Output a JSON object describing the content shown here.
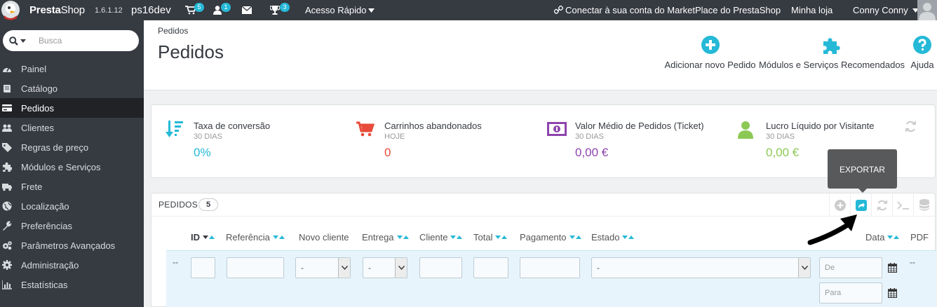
{
  "topbar": {
    "brand_presta": "Presta",
    "brand_shop": "Shop",
    "version": "1.6.1.12",
    "shop_name": "ps16dev",
    "badges": {
      "orders": "5",
      "customers": "1",
      "trophies": "3"
    },
    "quick_access": "Acesso Rápido",
    "marketplace": "Conectar à sua conta do MarketPlace do PrestaShop",
    "my_store": "Minha loja",
    "user": "Conny Conny"
  },
  "sidebar": {
    "search_placeholder": "Busca",
    "items": [
      {
        "label": "Painel",
        "icon": "dashboard-icon"
      },
      {
        "label": "Catálogo",
        "icon": "book-icon"
      },
      {
        "label": "Pedidos",
        "icon": "credit-card-icon",
        "active": true
      },
      {
        "label": "Clientes",
        "icon": "users-icon"
      },
      {
        "label": "Regras de preço",
        "icon": "tag-icon"
      },
      {
        "label": "Módulos e Serviços",
        "icon": "puzzle-icon"
      },
      {
        "label": "Frete",
        "icon": "truck-icon"
      },
      {
        "label": "Localização",
        "icon": "globe-icon"
      },
      {
        "label": "Preferências",
        "icon": "wrench-icon"
      },
      {
        "label": "Parâmetros Avançados",
        "icon": "cogs-icon"
      },
      {
        "label": "Administração",
        "icon": "gear-icon"
      },
      {
        "label": "Estatísticas",
        "icon": "bar-chart-icon"
      }
    ]
  },
  "header": {
    "breadcrumb": "Pedidos",
    "title": "Pedidos",
    "buttons": {
      "add": "Adicionar novo Pedido",
      "modules": "Módulos e Serviços Recomendados",
      "help": "Ajuda"
    }
  },
  "kpis": [
    {
      "title": "Taxa de conversão",
      "period": "30 DIAS",
      "value": "0%",
      "color": "#25b9d7",
      "icon": "sort-down-icon"
    },
    {
      "title": "Carrinhos abandonados",
      "period": "HOJE",
      "value": "0",
      "color": "#e84b3b",
      "icon": "cart-icon"
    },
    {
      "title": "Valor Médio de Pedidos (Ticket)",
      "period": "30 DIAS",
      "value": "0,00 €",
      "color": "#8e44ad",
      "icon": "money-icon"
    },
    {
      "title": "Lucro Líquido por Visitante",
      "period": "30 DIAS",
      "value": "0,00 €",
      "color": "#8bc954",
      "icon": "user-icon"
    }
  ],
  "orders": {
    "title": "PEDIDOS",
    "count": "5",
    "tooltip": "EXPORTAR",
    "columns": {
      "id": "ID",
      "reference": "Referência",
      "new_client": "Novo cliente",
      "delivery": "Entrega",
      "customer": "Cliente",
      "total": "Total",
      "payment": "Pagamento",
      "status": "Estado",
      "date": "Data",
      "pdf": "PDF"
    },
    "filters": {
      "row_marker": "--",
      "new_client_value": "-",
      "delivery_value": "-",
      "status_value": "-",
      "date_from": "De",
      "date_to": "Para",
      "pdf_marker": "--"
    }
  }
}
